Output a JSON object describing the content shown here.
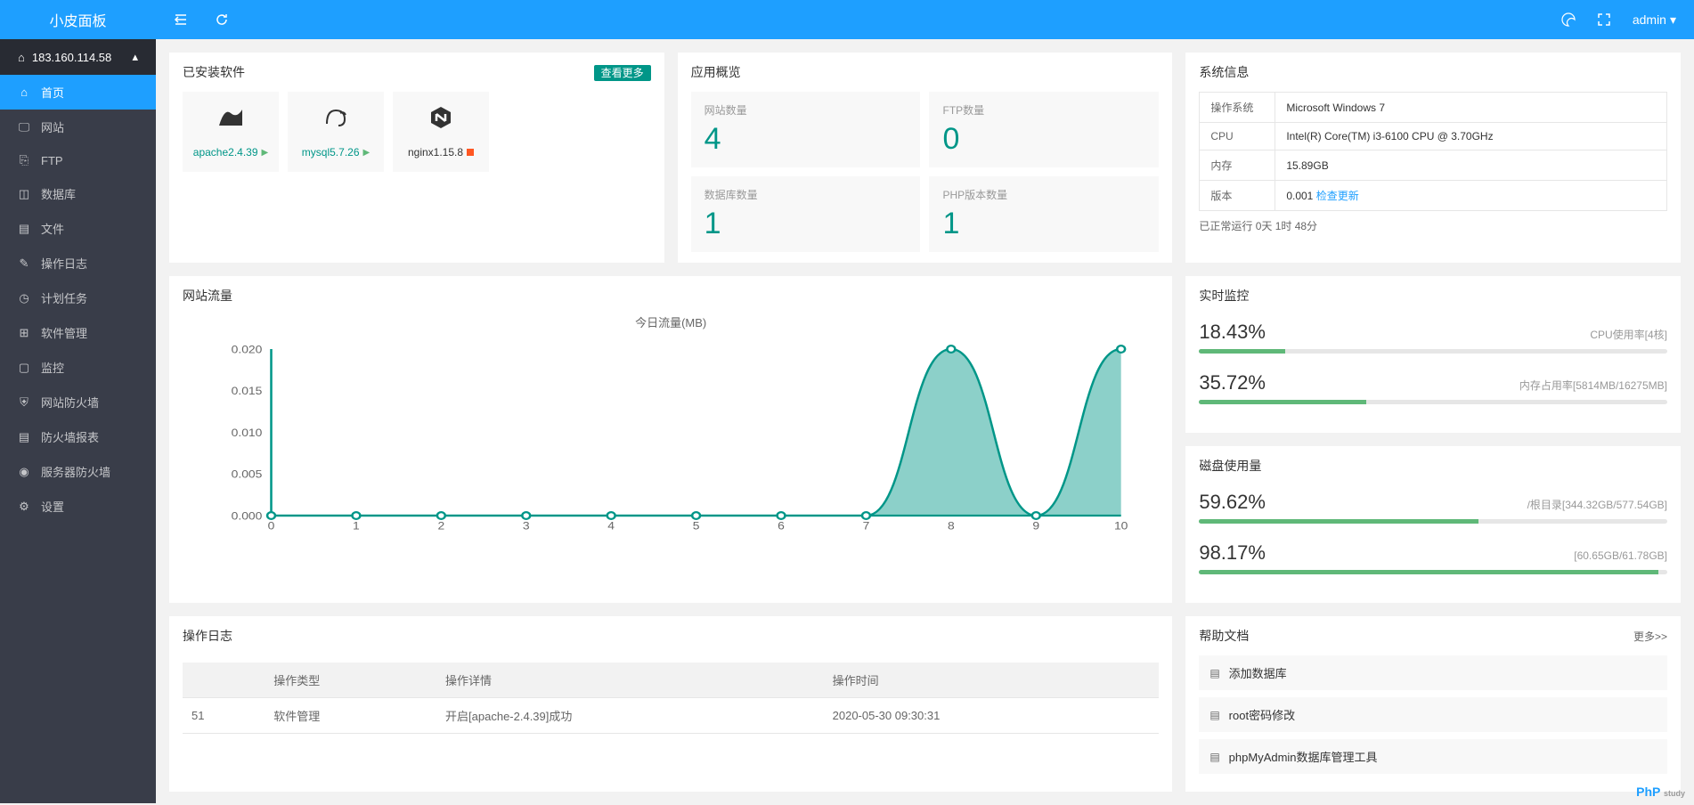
{
  "brand": "小皮面板",
  "ip": "183.160.114.58",
  "user": "admin",
  "sidebar": {
    "items": [
      {
        "label": "首页",
        "icon": "home",
        "active": true
      },
      {
        "label": "网站",
        "icon": "monitor"
      },
      {
        "label": "FTP",
        "icon": "ftp"
      },
      {
        "label": "数据库",
        "icon": "db"
      },
      {
        "label": "文件",
        "icon": "folder"
      },
      {
        "label": "操作日志",
        "icon": "log"
      },
      {
        "label": "计划任务",
        "icon": "task"
      },
      {
        "label": "软件管理",
        "icon": "soft"
      },
      {
        "label": "监控",
        "icon": "watch"
      },
      {
        "label": "网站防火墙",
        "icon": "shield"
      },
      {
        "label": "防火墙报表",
        "icon": "report"
      },
      {
        "label": "服务器防火墙",
        "icon": "firewall"
      },
      {
        "label": "设置",
        "icon": "gear"
      }
    ]
  },
  "installed": {
    "title": "已安装软件",
    "more": "查看更多",
    "items": [
      {
        "name": "apache2.4.39",
        "status": "running"
      },
      {
        "name": "mysql5.7.26",
        "status": "running"
      },
      {
        "name": "nginx1.15.8",
        "status": "stopped"
      }
    ]
  },
  "overview": {
    "title": "应用概览",
    "items": [
      {
        "label": "网站数量",
        "value": "4"
      },
      {
        "label": "FTP数量",
        "value": "0"
      },
      {
        "label": "数据库数量",
        "value": "1"
      },
      {
        "label": "PHP版本数量",
        "value": "1"
      }
    ]
  },
  "sysinfo": {
    "title": "系统信息",
    "rows": [
      {
        "k": "操作系统",
        "v": "Microsoft Windows 7"
      },
      {
        "k": "CPU",
        "v": "Intel(R) Core(TM) i3-6100 CPU @ 3.70GHz"
      },
      {
        "k": "内存",
        "v": "15.89GB"
      },
      {
        "k": "版本",
        "v": "0.001",
        "link": "检查更新"
      }
    ],
    "uptime_prefix": "已正常运行",
    "uptime": "0天 1时 48分"
  },
  "traffic": {
    "title": "网站流量"
  },
  "chart_data": {
    "type": "area",
    "title": "今日流量(MB)",
    "x": [
      0,
      1,
      2,
      3,
      4,
      5,
      6,
      7,
      8,
      9,
      10
    ],
    "values": [
      0,
      0,
      0,
      0,
      0,
      0,
      0,
      0,
      0.02,
      0,
      0.02
    ],
    "xlabel": "",
    "ylabel": "",
    "ylim": [
      0,
      0.02
    ],
    "yticks": [
      0,
      0.005,
      0.01,
      0.015,
      0.02
    ]
  },
  "monitor": {
    "title": "实时监控",
    "items": [
      {
        "value": "18.43%",
        "label": "CPU使用率[4核]",
        "pct": 18.43
      },
      {
        "value": "35.72%",
        "label": "内存占用率[5814MB/16275MB]",
        "pct": 35.72
      }
    ]
  },
  "disk": {
    "title": "磁盘使用量",
    "items": [
      {
        "value": "59.62%",
        "label": "/根目录[344.32GB/577.54GB]",
        "pct": 59.62
      },
      {
        "value": "98.17%",
        "label": "[60.65GB/61.78GB]",
        "pct": 98.17
      }
    ]
  },
  "help": {
    "title": "帮助文档",
    "more": "更多>>",
    "items": [
      {
        "label": "添加数据库"
      },
      {
        "label": "root密码修改"
      },
      {
        "label": "phpMyAdmin数据库管理工具"
      }
    ]
  },
  "oplog": {
    "title": "操作日志",
    "headers": [
      "",
      "操作类型",
      "操作详情",
      "操作时间"
    ],
    "rows": [
      {
        "id": "51",
        "type": "软件管理",
        "detail": "开启[apache-2.4.39]成功",
        "time": "2020-05-30 09:30:31"
      }
    ]
  },
  "watermark": {
    "a": "PhP",
    "b": "study"
  }
}
